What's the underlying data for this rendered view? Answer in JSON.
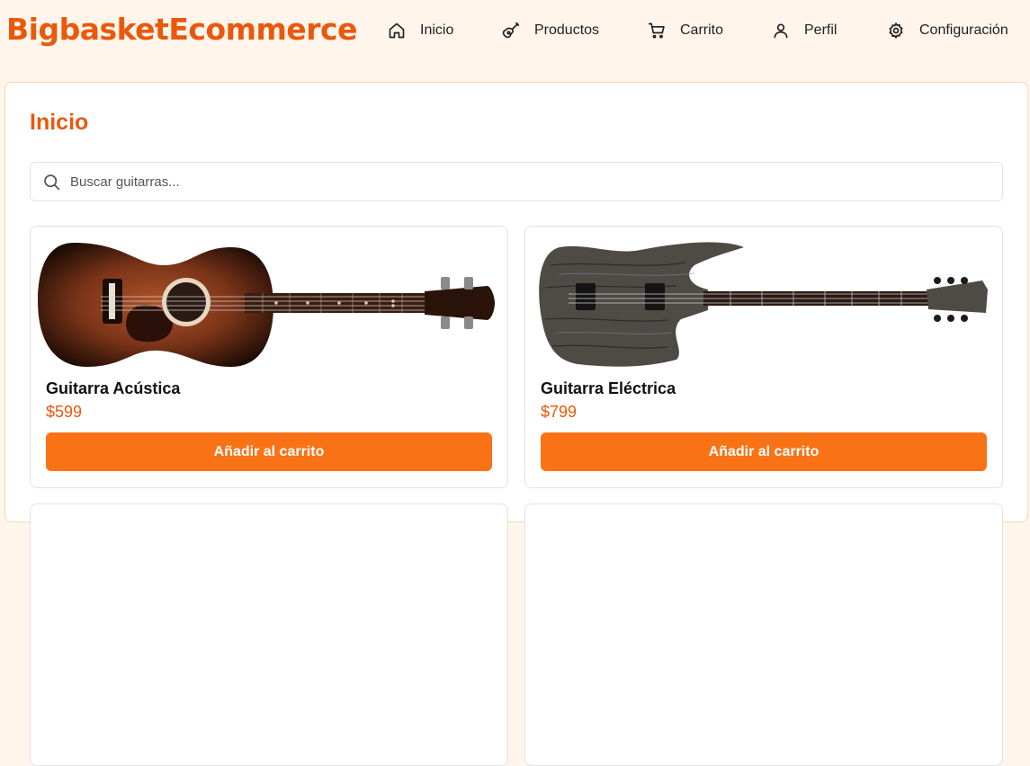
{
  "brand": "BigbasketEcommerce",
  "nav": [
    {
      "label": "Inicio",
      "icon": "home-icon"
    },
    {
      "label": "Productos",
      "icon": "guitar-icon"
    },
    {
      "label": "Carrito",
      "icon": "cart-icon"
    },
    {
      "label": "Perfil",
      "icon": "user-icon"
    },
    {
      "label": "Configuración",
      "icon": "gear-icon"
    }
  ],
  "page": {
    "title": "Inicio"
  },
  "search": {
    "placeholder": "Buscar guitarras...",
    "value": "",
    "icon": "search-icon"
  },
  "products": [
    {
      "name": "Guitarra Acústica",
      "price": "$599",
      "button": "Añadir al carrito",
      "image": "acoustic-guitar-image"
    },
    {
      "name": "Guitarra Eléctrica",
      "price": "$799",
      "button": "Añadir al carrito",
      "image": "electric-guitar-image"
    }
  ],
  "colors": {
    "accent": "#ea580c",
    "button": "#f97316",
    "background": "#fff5eb"
  }
}
